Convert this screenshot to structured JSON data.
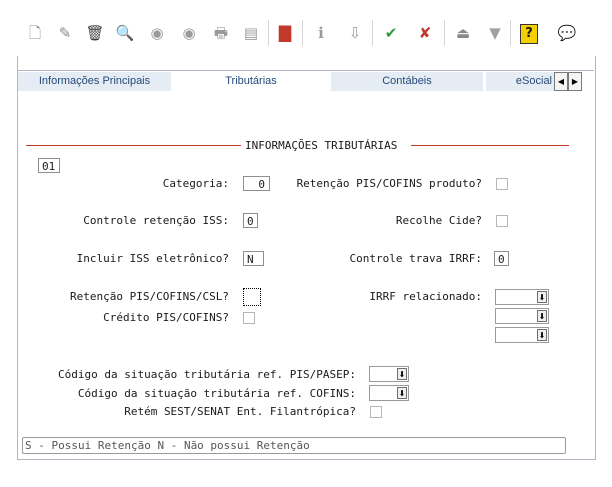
{
  "toolbar": {
    "buttons": [
      {
        "name": "new-icon",
        "glyph": "🗋",
        "color": "#8a8a8a"
      },
      {
        "name": "edit-icon",
        "glyph": "✎",
        "color": "#8a8a8a"
      },
      {
        "name": "delete-icon",
        "glyph": "🗑",
        "color": "#3c3c3c"
      },
      {
        "name": "search-icon",
        "glyph": "🔍",
        "color": "#4a4a4a"
      },
      {
        "name": "previous-icon",
        "glyph": "◉",
        "color": "#9a9a9a"
      },
      {
        "name": "next-icon",
        "glyph": "◉",
        "color": "#9a9a9a"
      },
      {
        "name": "print-icon",
        "glyph": "🖶",
        "color": "#9a9a9a"
      },
      {
        "name": "export-icon",
        "glyph": "▤",
        "color": "#9a9a9a"
      },
      {
        "name": "binoculars-icon",
        "glyph": "▇",
        "color": "#c0392b"
      },
      {
        "name": "info-icon",
        "glyph": "ℹ",
        "color": "#9a9a9a"
      },
      {
        "name": "sort-icon",
        "glyph": "⇩",
        "color": "#9a9a9a"
      },
      {
        "name": "confirm-icon",
        "glyph": "✔",
        "color": "#2e9d3a"
      },
      {
        "name": "cancel-icon",
        "glyph": "✘",
        "color": "#c0392b"
      },
      {
        "name": "eject-icon",
        "glyph": "⏏",
        "color": "#8a8a8a"
      },
      {
        "name": "filter-icon",
        "glyph": "▼",
        "color": "#a0a0a0"
      },
      {
        "name": "help-icon",
        "glyph": "?",
        "color": "#1a1a1a"
      },
      {
        "name": "comment-icon",
        "glyph": "💬",
        "color": "#4a4a4a"
      }
    ]
  },
  "tabs": [
    {
      "label": "Informações Principais",
      "active": false
    },
    {
      "label": "Tributárias",
      "active": true
    },
    {
      "label": "Contábeis",
      "active": false
    },
    {
      "label": "eSocial",
      "active": false
    }
  ],
  "section": {
    "title": "INFORMAÇÕES TRIBUTÁRIAS"
  },
  "form": {
    "code_value": "01",
    "categoria_label": "Categoria:",
    "categoria_value": "0",
    "retencao_produto_label": "Retenção PIS/COFINS produto?",
    "controle_iss_label": "Controle retenção ISS:",
    "controle_iss_value": "0",
    "recolhe_cide_label": "Recolhe Cide?",
    "incluir_iss_label": "Incluir ISS eletrônico?",
    "incluir_iss_value": "N",
    "controle_irrf_label": "Controle trava IRRF:",
    "controle_irrf_value": "0",
    "retencao_csl_label": "Retenção PIS/COFINS/CSL?",
    "irrf_relacionado_label": "IRRF relacionado:",
    "credito_label": "Crédito PIS/COFINS?",
    "cst_pis_label": "Código da situação tributária ref. PIS/PASEP:",
    "cst_cofins_label": "Código da situação tributária ref. COFINS:",
    "retem_sest_label": "Retém SEST/SENAT Ent. Filantrópica?"
  },
  "statusbar": {
    "text": "S - Possui Retenção    N - Não possui Retenção"
  }
}
